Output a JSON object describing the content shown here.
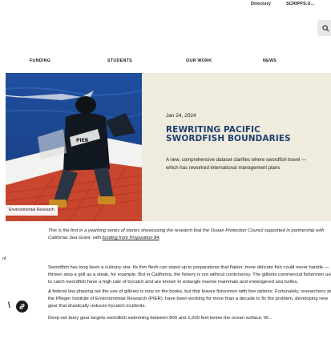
{
  "utility_nav": {
    "directory": "Directory",
    "scripps": "SCRIPPS.U..."
  },
  "main_nav": {
    "items": [
      "FUNDING",
      "STUDENTS",
      "OUR WORK",
      "NEWS"
    ]
  },
  "hero": {
    "caption": "Environmental Research",
    "date": "Jan 24, 2024",
    "title": "REWRITING PACIFIC SWORDFISH BOUNDARIES",
    "subtitle": "A new, comprehensive dataset clarifies where swordfish travel — which has reworked international management plans"
  },
  "article": {
    "intro_text": "This is the first in a yearlong series of stories showcasing the research that the Ocean Protection Council supported in partnership with California Sea Grant, with ",
    "intro_link": "funding from Proposition 84",
    "intro_end": ".",
    "side_fragment": "nt",
    "paragraphs": [
      "Swordfish has long been a culinary star. Its firm flesh can stand up to preparations that flakier, more delicate fish could never handle — thrown atop a grill as a steak, for example. But in California, the fishery is not without controversy. The gillnets commercial fishermen use to catch swordfish have a high rate of bycatch and are known to entangle marine mammals and endangered sea turtles.",
      "A federal law phasing out the use of gillnets is now on the books, but that leaves fishermen with few options. Fortunately, researchers at the Pfleger Institute of Environmental Research (PIER), have been working for more than a decade to fix the problem, developing new gear that drastically reduces bycatch incidents.",
      "Deep-set buoy gear targets swordfish swimming between 800 and 1,200 feet below the ocean surface. W..."
    ]
  },
  "colors": {
    "title_navy": "#1f3e6f",
    "panel_beige": "#efebdd",
    "ocean_blue": "#2a4e9a"
  }
}
